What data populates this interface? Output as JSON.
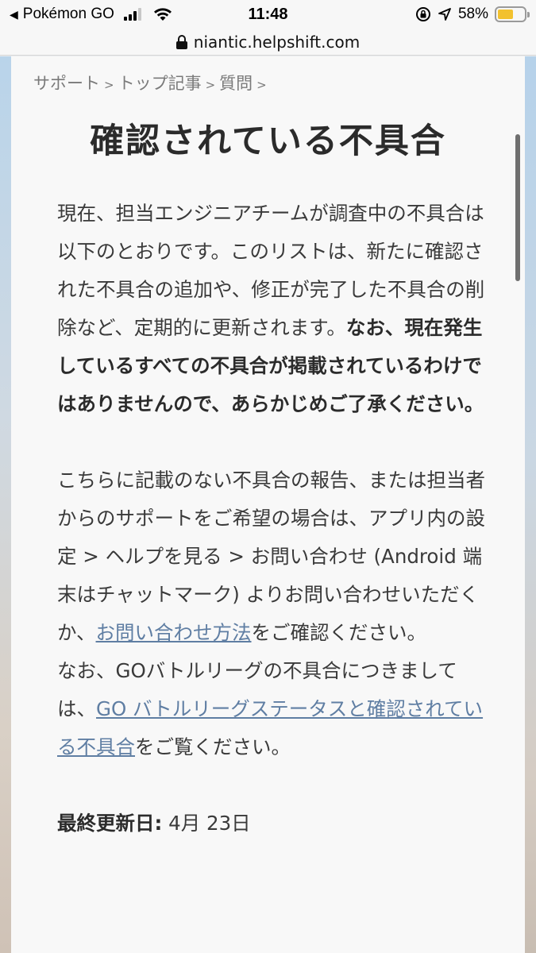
{
  "status_bar": {
    "back_app": "Pokémon GO",
    "time": "11:48",
    "battery_percent": "58%",
    "battery_level": 0.58,
    "battery_color": "#f2c12e"
  },
  "url_bar": {
    "domain": "niantic.helpshift.com"
  },
  "breadcrumb": {
    "items": [
      "サポート",
      "トップ記事",
      "質問"
    ],
    "separator": ">"
  },
  "page_title": "確認されている不具合",
  "paragraph1": {
    "normal": "現在、担当エンジニアチームが調査中の不具合は以下のとおりです。このリストは、新たに確認された不具合の追加や、修正が完了した不具合の削除など、定期的に更新されます。",
    "bold": "なお、現在発生しているすべての不具合が掲載されているわけではありませんので、あらかじめご了承ください。"
  },
  "paragraph2": {
    "text1": "こちらに記載のない不具合の報告、または担当者からのサポートをご希望の場合は、アプリ内の設定 > ヘルプを見る > お問い合わせ (Android 端末はチャットマーク) よりお問い合わせいただくか、",
    "link1": "お問い合わせ方法",
    "text2": "をご確認ください。"
  },
  "paragraph3": {
    "text1": "なお、GOバトルリーグの不具合につきましては、",
    "link1": "GO バトルリーグステータスと確認されている不具合",
    "text2": "をご覧ください。"
  },
  "last_updated": {
    "label": "最終更新日:",
    "value": "4月 23日"
  },
  "colors": {
    "link": "#5f7ea3",
    "text": "#3a3a3a",
    "title": "#2b2b2b"
  }
}
